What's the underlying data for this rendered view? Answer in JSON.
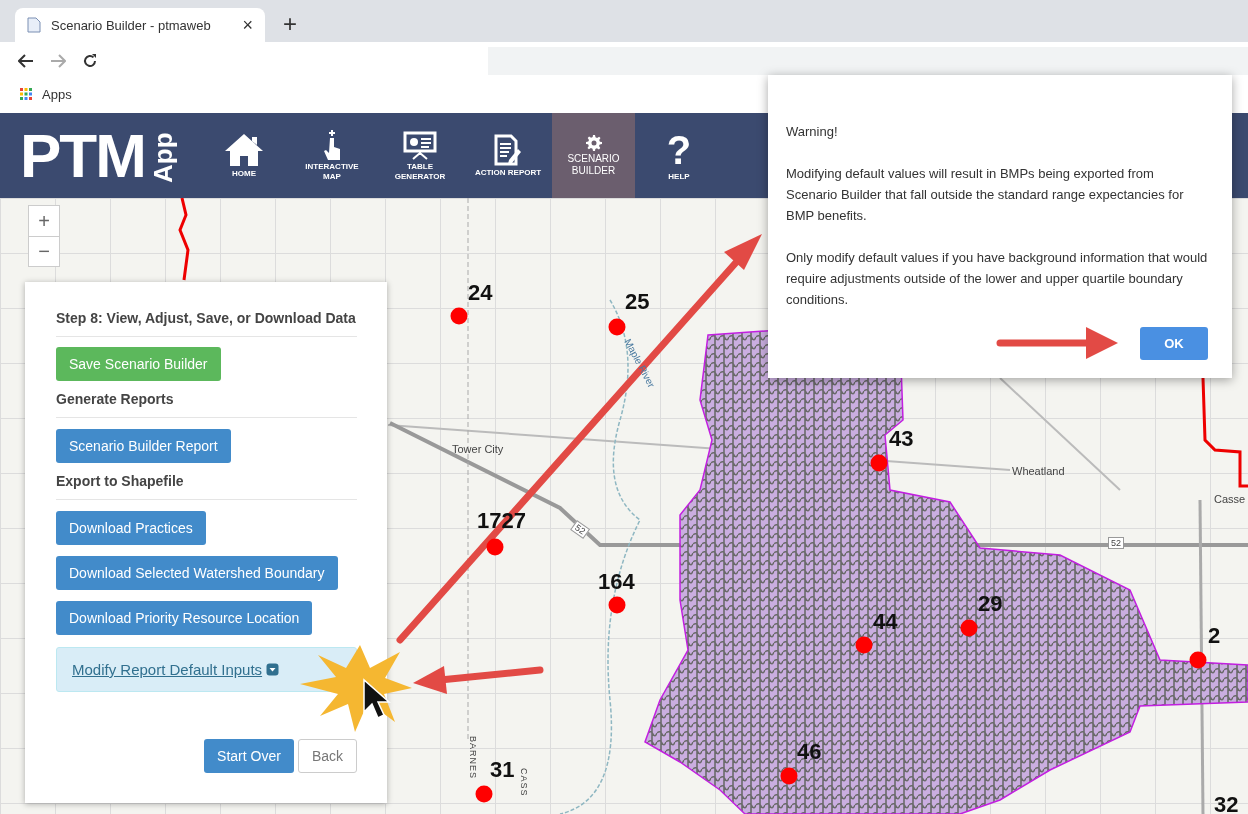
{
  "browser": {
    "tab_title": "Scenario Builder - ptmaweb",
    "close_glyph": "×",
    "new_tab_glyph": "+",
    "bookmarks": [
      "Apps"
    ]
  },
  "header": {
    "logo": {
      "main": "PTM",
      "side": "App"
    },
    "nav": [
      {
        "label": "HOME",
        "kind": "home",
        "selected": false
      },
      {
        "label": "INTERACTIVE MAP",
        "kind": "pointer",
        "selected": false
      },
      {
        "label": "TABLE GENERATOR",
        "kind": "easel",
        "selected": false
      },
      {
        "label": "ACTION REPORT",
        "kind": "document",
        "selected": false
      },
      {
        "label": "SCENARIO BUILDER",
        "kind": "gear",
        "selected": true
      },
      {
        "label": "HELP",
        "kind": "help",
        "glyph": "?",
        "selected": false
      }
    ]
  },
  "map": {
    "zoom_controls": [
      "+",
      "−"
    ],
    "sites": [
      {
        "label": "24"
      },
      {
        "label": "25"
      },
      {
        "label": "43"
      },
      {
        "label": "1727"
      },
      {
        "label": "164"
      },
      {
        "label": "44"
      },
      {
        "label": "29"
      },
      {
        "label": "2"
      },
      {
        "label": "46"
      },
      {
        "label": "31"
      },
      {
        "label": "32"
      }
    ],
    "places": [
      {
        "label": "Tower City",
        "kind": "town"
      },
      {
        "label": "Maple River",
        "kind": "river"
      },
      {
        "label": "Wheatland",
        "kind": "town"
      },
      {
        "label": "Casse",
        "kind": "town"
      },
      {
        "label": "52",
        "kind": "highway"
      },
      {
        "label": "52",
        "kind": "highway"
      },
      {
        "label": "BARNES",
        "kind": "county"
      },
      {
        "label": "CASS",
        "kind": "county"
      }
    ]
  },
  "panel": {
    "title": "Step 8: View, Adjust, Save, or Download Data",
    "save_button": "Save Scenario Builder",
    "sections": [
      {
        "heading": "Generate Reports",
        "buttons": [
          "Scenario Builder Report"
        ]
      },
      {
        "heading": "Export to Shapefile",
        "buttons": [
          "Download Practices",
          "Download Selected Watershed Boundary",
          "Download Priority Resource Location"
        ]
      }
    ],
    "modify_link": "Modify Report Default Inputs",
    "footer_buttons": [
      {
        "label": "Start Over",
        "kind": "primary"
      },
      {
        "label": "Back",
        "kind": "default"
      }
    ]
  },
  "dialog": {
    "paragraphs": [
      "Warning!",
      "Modifying default values will result in BMPs being exported from Scenario Builder that fall outside the standard range expectancies for BMP benefits.",
      "Only modify default values if you have background information that would require adjustments outside of the lower and upper quartile boundary conditions."
    ],
    "button": "OK"
  }
}
